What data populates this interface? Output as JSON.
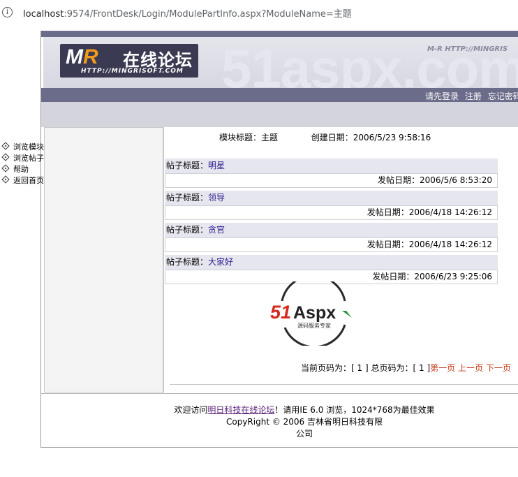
{
  "browser": {
    "url_host": "localhost",
    "url_rest": ":9574/FrontDesk/Login/ModulePartInfo.aspx?ModuleName=主题"
  },
  "banner": {
    "logo_mr_m": "M",
    "logo_mr_r": "R",
    "logo_cn": "在线论坛",
    "logo_url": "HTTP://MINGRISOFT.COM",
    "watermark": "51aspx.com",
    "watermark_url": "M-R HTTP://MINGRIS"
  },
  "nav": {
    "login": "请先登录",
    "register": "注册",
    "forgot": "忘记密码"
  },
  "sidebar": {
    "items": [
      {
        "label": "浏览模块"
      },
      {
        "label": "浏览帖子"
      },
      {
        "label": "帮助"
      },
      {
        "label": "返回首页"
      }
    ]
  },
  "module": {
    "title_label": "模块标题：",
    "title_value": "主题",
    "created_label": "创建日期：",
    "created_value": "2006/5/23 9:58:16"
  },
  "posts": [
    {
      "title_label": "帖子标题：",
      "title": "明星",
      "date_label": "发帖日期：",
      "date": "2006/5/6 8:53:20"
    },
    {
      "title_label": "帖子标题：",
      "title": "领导",
      "date_label": "发帖日期：",
      "date": "2006/4/18 14:26:12"
    },
    {
      "title_label": "帖子标题：",
      "title": "贪官",
      "date_label": "发帖日期：",
      "date": "2006/4/18 14:26:12"
    },
    {
      "title_label": "帖子标题：",
      "title": "大家好",
      "date_label": "发帖日期：",
      "date": "2006/6/23 9:25:06"
    }
  ],
  "aspx_logo": {
    "main_51": "51",
    "main_aspx": "Aspx",
    "sub": "源码服务专家"
  },
  "pager": {
    "current_label": "当前页码为：",
    "current_value": "[ 1 ]",
    "total_label": "总页码为：",
    "total_value": "[ 1 ]",
    "first": "第一页",
    "prev": "上一页",
    "next": "下一页"
  },
  "footer": {
    "welcome": "欢迎访问",
    "site_link": "明日科技在线论坛",
    "notice": "！请用IE 6.0 浏览，1024*768为最佳效果",
    "copyright": "CopyRight © 2006 吉林省明日科技有限公司"
  },
  "colors": {
    "nav_bg": "#6b6b8a",
    "post_title_color": "#2a1d8f",
    "pager_link_color": "#c33a17"
  }
}
